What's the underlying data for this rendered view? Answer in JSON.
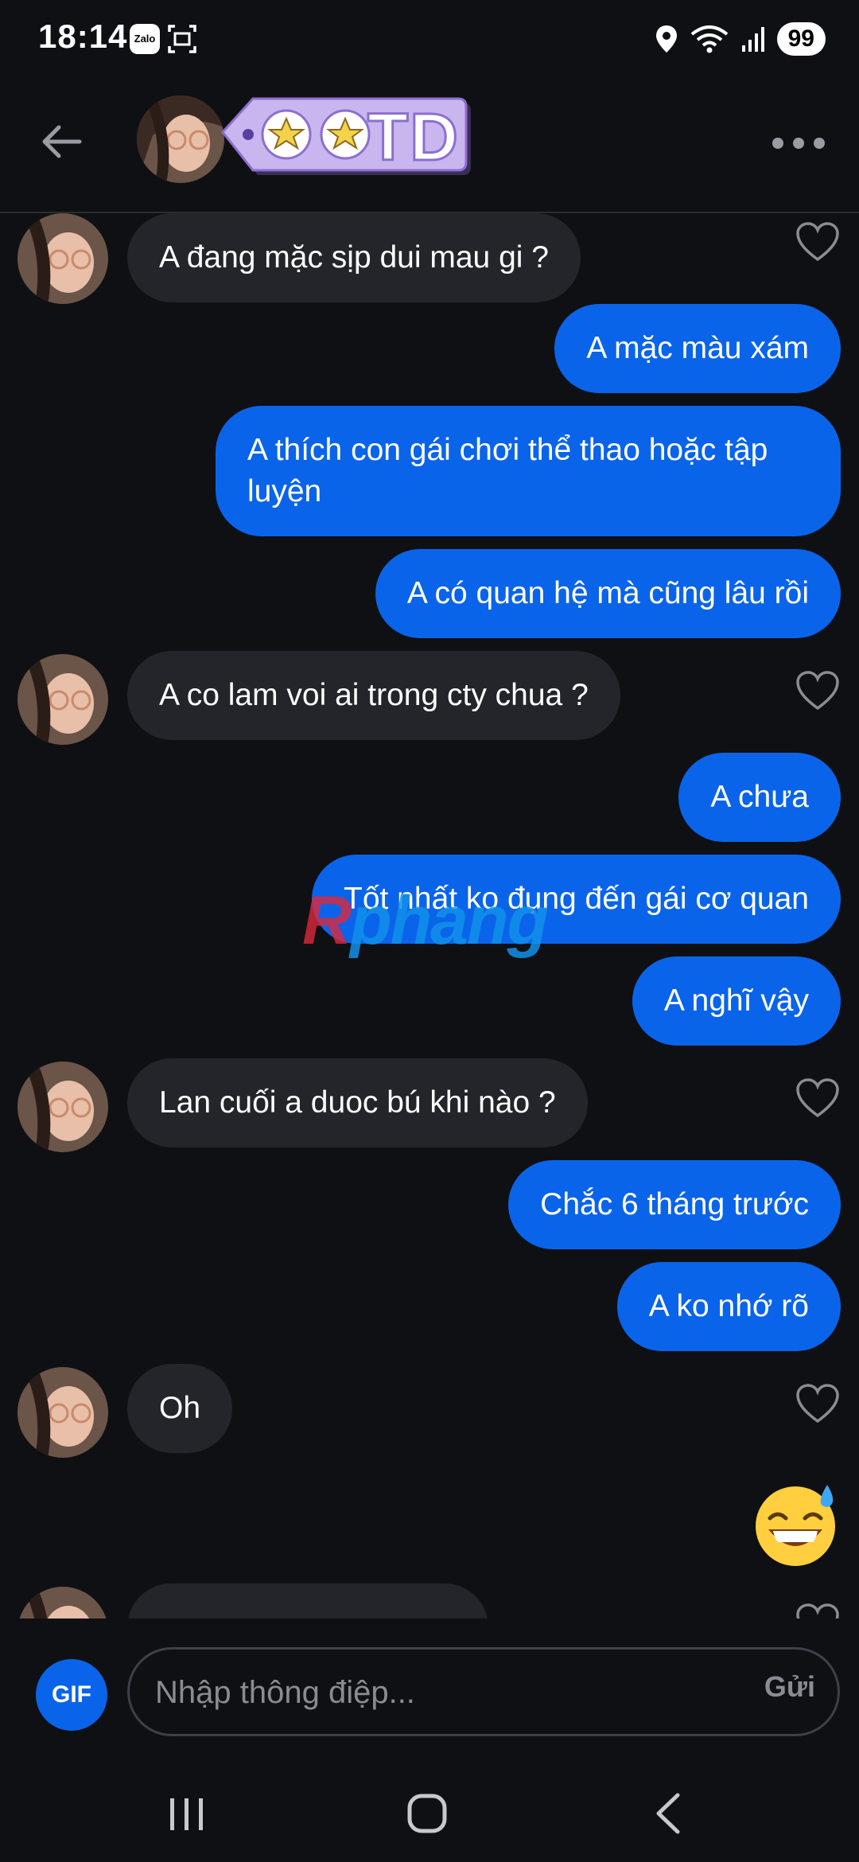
{
  "status_bar": {
    "time": "18:14",
    "zalo_label": "Zalo",
    "battery": "99",
    "icons": [
      "zalo-icon",
      "screenshot-icon",
      "location-icon",
      "wifi-icon",
      "signal-icon",
      "battery-icon"
    ]
  },
  "header": {
    "badge_text": "TD",
    "icons": [
      "back-arrow-icon",
      "star-icon",
      "more-icon"
    ]
  },
  "messages": [
    {
      "side": "in",
      "text": "A đang mặc sịp dui mau gi ?"
    },
    {
      "side": "out",
      "text": "A mặc màu xám"
    },
    {
      "side": "out",
      "text": "A thích con gái chơi thể thao hoặc tập luyện"
    },
    {
      "side": "out",
      "text": "A có quan hệ mà cũng lâu rồi"
    },
    {
      "side": "in",
      "text": "A co lam voi ai trong cty chua ?"
    },
    {
      "side": "out",
      "text": "A chưa"
    },
    {
      "side": "out",
      "text": "Tốt nhất ko đụng đến gái cơ quan"
    },
    {
      "side": "out",
      "text": "A nghĩ vậy"
    },
    {
      "side": "in",
      "text": "Lan cuối a duoc bú khi nào ?"
    },
    {
      "side": "out",
      "text": "Chắc 6 tháng trước"
    },
    {
      "side": "out",
      "text": "A ko nhớ rõ"
    },
    {
      "side": "in",
      "text": "Oh"
    },
    {
      "side": "out",
      "emoji": "grinning-sweat-emoji"
    }
  ],
  "watermark": {
    "first": "R",
    "rest": "phang"
  },
  "composer": {
    "gif_label": "GIF",
    "placeholder": "Nhập thông điệp...",
    "send_label": "Gửi"
  },
  "navbar": {
    "icons": [
      "recent-apps-icon",
      "home-icon",
      "back-icon"
    ]
  },
  "colors": {
    "background": "#0f1013",
    "incoming_bubble": "#23252a",
    "outgoing_bubble": "#0a64ea",
    "accent": "#0a64ea",
    "badge": "#c9b6ee"
  }
}
